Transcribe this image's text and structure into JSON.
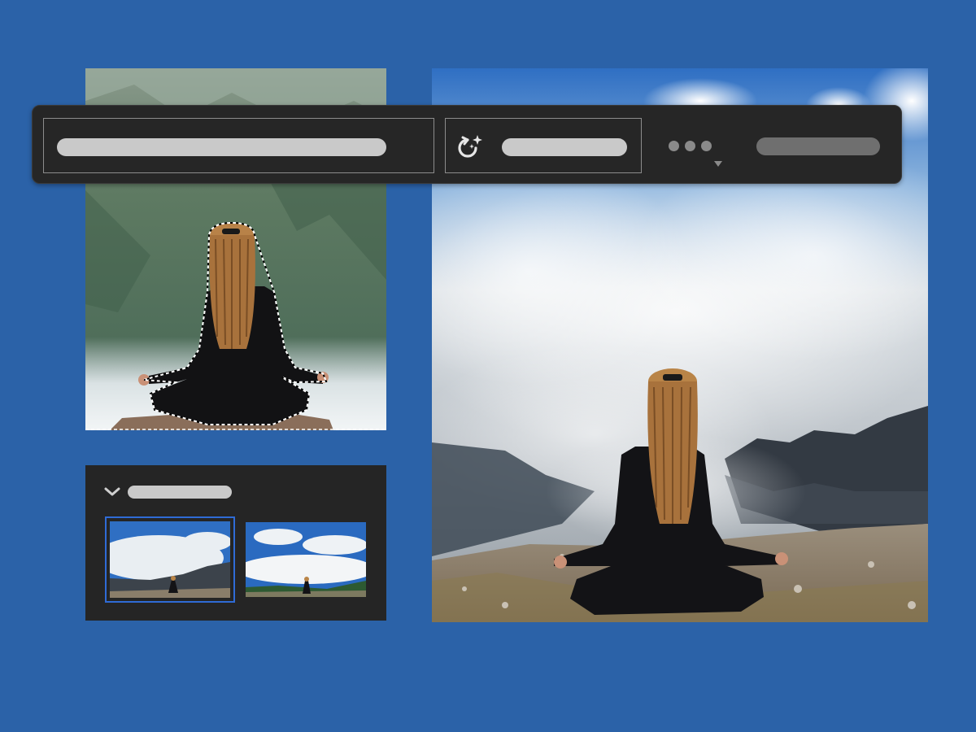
{
  "app": {
    "title": ""
  },
  "colors": {
    "background": "#2b62a8",
    "panel": "#252525",
    "taskbar": "#262626",
    "selected_outline": "#2f6bd6",
    "placeholder_bar": "#c9c9c9",
    "secondary_bar": "#6f6f6f"
  },
  "taskbar": {
    "prompt_placeholder": "",
    "generate_label": "",
    "generate_icon": "sparkle-refresh-icon",
    "more_icon": "more-dots-icon",
    "secondary_label": ""
  },
  "variations_panel": {
    "title": "",
    "collapse_icon": "chevron-down-icon",
    "thumbnails": [
      {
        "selected": true
      },
      {
        "selected": false
      }
    ]
  }
}
